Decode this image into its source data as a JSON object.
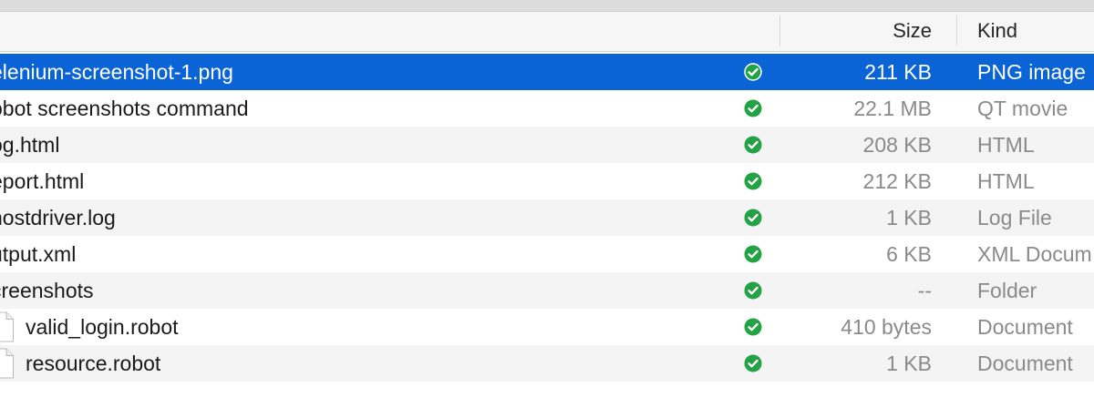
{
  "header": {
    "columns": {
      "size": "Size",
      "kind": "Kind"
    }
  },
  "rows": [
    {
      "name": "elenium-screenshot-1.png",
      "size": "211 KB",
      "kind": "PNG image",
      "selected": true
    },
    {
      "name": "obot screenshots command",
      "size": "22.1 MB",
      "kind": "QT movie"
    },
    {
      "name": "og.html",
      "size": "208 KB",
      "kind": "HTML"
    },
    {
      "name": "eport.html",
      "size": "212 KB",
      "kind": "HTML"
    },
    {
      "name": "hostdriver.log",
      "size": "1 KB",
      "kind": "Log File"
    },
    {
      "name": "utput.xml",
      "size": "6 KB",
      "kind": "XML Docum"
    },
    {
      "name": "creenshots",
      "size": "--",
      "kind": "Folder"
    },
    {
      "name": "valid_login.robot",
      "size": "410 bytes",
      "kind": "Document",
      "child": true
    },
    {
      "name": "resource.robot",
      "size": "1 KB",
      "kind": "Document",
      "child": true
    },
    {
      "name": "",
      "size": "",
      "kind": ""
    }
  ],
  "colors": {
    "selection": "#0a64d6",
    "status_check": "#23a245",
    "secondary_text": "#8a8a8a"
  },
  "icons": {
    "status": "check-circle-icon",
    "file": "document-icon"
  }
}
